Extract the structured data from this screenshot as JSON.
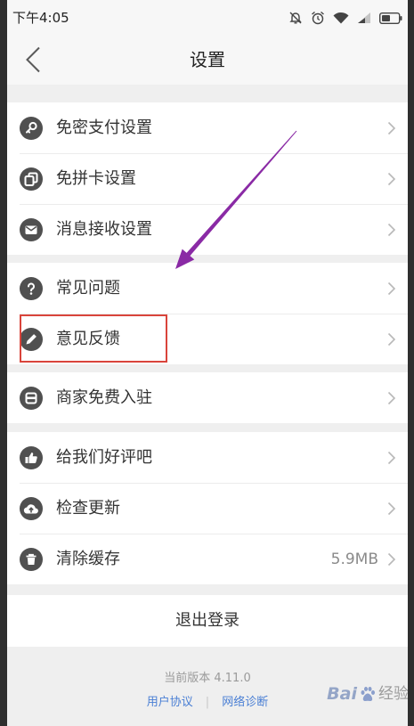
{
  "status_bar": {
    "time": "下午4:05",
    "icons": [
      "mute-icon",
      "alarm-icon",
      "wifi-icon",
      "signal-icon",
      "battery-icon"
    ]
  },
  "header": {
    "title": "设置",
    "back_icon": "chevron-left-icon"
  },
  "groups": [
    {
      "items": [
        {
          "label": "免密支付设置",
          "icon": "key-icon"
        },
        {
          "label": "免拼卡设置",
          "icon": "cards-icon"
        },
        {
          "label": "消息接收设置",
          "icon": "message-icon"
        }
      ]
    },
    {
      "items": [
        {
          "label": "常见问题",
          "icon": "question-icon"
        },
        {
          "label": "意见反馈",
          "icon": "pencil-icon",
          "highlighted": true
        }
      ]
    },
    {
      "items": [
        {
          "label": "商家免费入驻",
          "icon": "store-icon"
        }
      ]
    },
    {
      "items": [
        {
          "label": "给我们好评吧",
          "icon": "thumbs-up-icon"
        },
        {
          "label": "检查更新",
          "icon": "cloud-upload-icon"
        },
        {
          "label": "清除缓存",
          "icon": "trash-icon",
          "value": "5.9MB"
        }
      ]
    }
  ],
  "row_chevron_icon": "chevron-right-icon",
  "logout": {
    "label": "退出登录"
  },
  "footer": {
    "version": "当前版本 4.11.0",
    "links": [
      "用户协议",
      "网络诊断"
    ],
    "separator": "|"
  },
  "watermark": {
    "brand": "Bai",
    "product": "经验"
  },
  "colors": {
    "link": "#4a7fd4",
    "icon_fill": "#505050",
    "text": "#333333",
    "separator_bg": "#efefef",
    "highlight": "#d9443b",
    "arrow": "#8a2aa5"
  }
}
